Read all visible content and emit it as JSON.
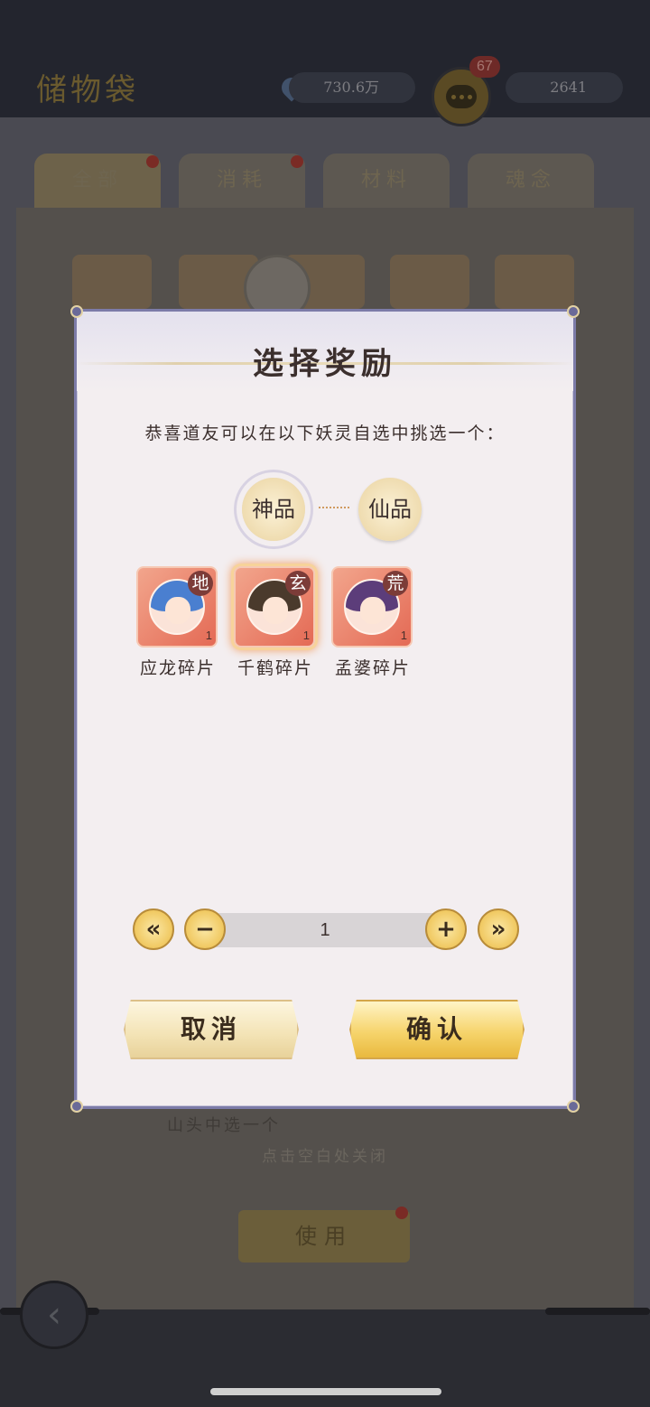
{
  "background": {
    "title": "储物袋",
    "resources": [
      "730.6万",
      "2641"
    ],
    "chat_badge": "67",
    "tabs": [
      "全部",
      "消耗",
      "材料",
      "魂念"
    ],
    "lower_text": "山头中选一个",
    "close_tip": "点击空白处关闭",
    "use_button": "使用"
  },
  "modal": {
    "title": "选择奖励",
    "subtitle": "恭喜道友可以在以下妖灵自选中挑选一个：",
    "grades": [
      "神品",
      "仙品"
    ],
    "selected_grade": "神品",
    "items": [
      {
        "name": "应龙碎片",
        "rank": "地",
        "count": "1",
        "hair_color": "#4a7fd0",
        "selected": false
      },
      {
        "name": "千鹤碎片",
        "rank": "玄",
        "count": "1",
        "hair_color": "#4a3a2c",
        "selected": true
      },
      {
        "name": "孟婆碎片",
        "rank": "荒",
        "count": "1",
        "hair_color": "#5c3d7a",
        "selected": false
      }
    ],
    "quantity": {
      "value": "1",
      "min_label": "«",
      "minus_label": "−",
      "plus_label": "+",
      "max_label": "»"
    },
    "cancel_label": "取消",
    "confirm_label": "确认"
  },
  "colors": {
    "frame": "#7c7ba8",
    "card": "#e46a55",
    "gold": "#f0c860"
  }
}
